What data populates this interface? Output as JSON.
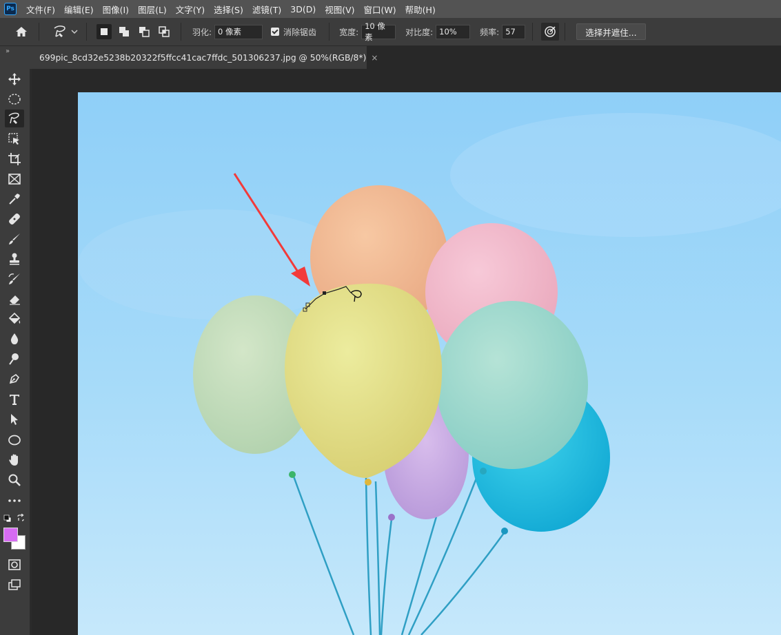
{
  "app": {
    "logo": "Ps"
  },
  "menu": [
    "文件(F)",
    "编辑(E)",
    "图像(I)",
    "图层(L)",
    "文字(Y)",
    "选择(S)",
    "滤镜(T)",
    "3D(D)",
    "视图(V)",
    "窗口(W)",
    "帮助(H)"
  ],
  "options": {
    "feather_label": "羽化:",
    "feather_value": "0 像素",
    "antialias_label": "消除锯齿",
    "antialias_checked": true,
    "width_label": "宽度:",
    "width_value": "10 像素",
    "contrast_label": "对比度:",
    "contrast_value": "10%",
    "frequency_label": "频率:",
    "frequency_value": "57",
    "select_mask_label": "选择并遮住..."
  },
  "tab": {
    "title": "699pic_8cd32e5238b20322f5ffcc41cac7ffdc_501306237.jpg @ 50%(RGB/8*)",
    "close": "×"
  },
  "panel_collapse": "»",
  "colors": {
    "foreground": "#d66cf2",
    "background": "#ffffff",
    "annotation_arrow": "#f23a3a"
  },
  "tools": [
    "move-tool",
    "elliptical-marquee-tool",
    "magnetic-lasso-tool",
    "object-selection-tool",
    "crop-tool",
    "frame-tool",
    "eyedropper-tool",
    "healing-brush-tool",
    "brush-tool",
    "clone-stamp-tool",
    "history-brush-tool",
    "eraser-tool",
    "paint-bucket-tool",
    "blur-tool",
    "dodge-tool",
    "pen-tool",
    "type-tool",
    "path-selection-tool",
    "ellipse-tool",
    "hand-tool",
    "zoom-tool",
    "more-tools",
    "quick-mask-tool",
    "screen-mode-tool"
  ],
  "active_tool": "magnetic-lasso-tool"
}
